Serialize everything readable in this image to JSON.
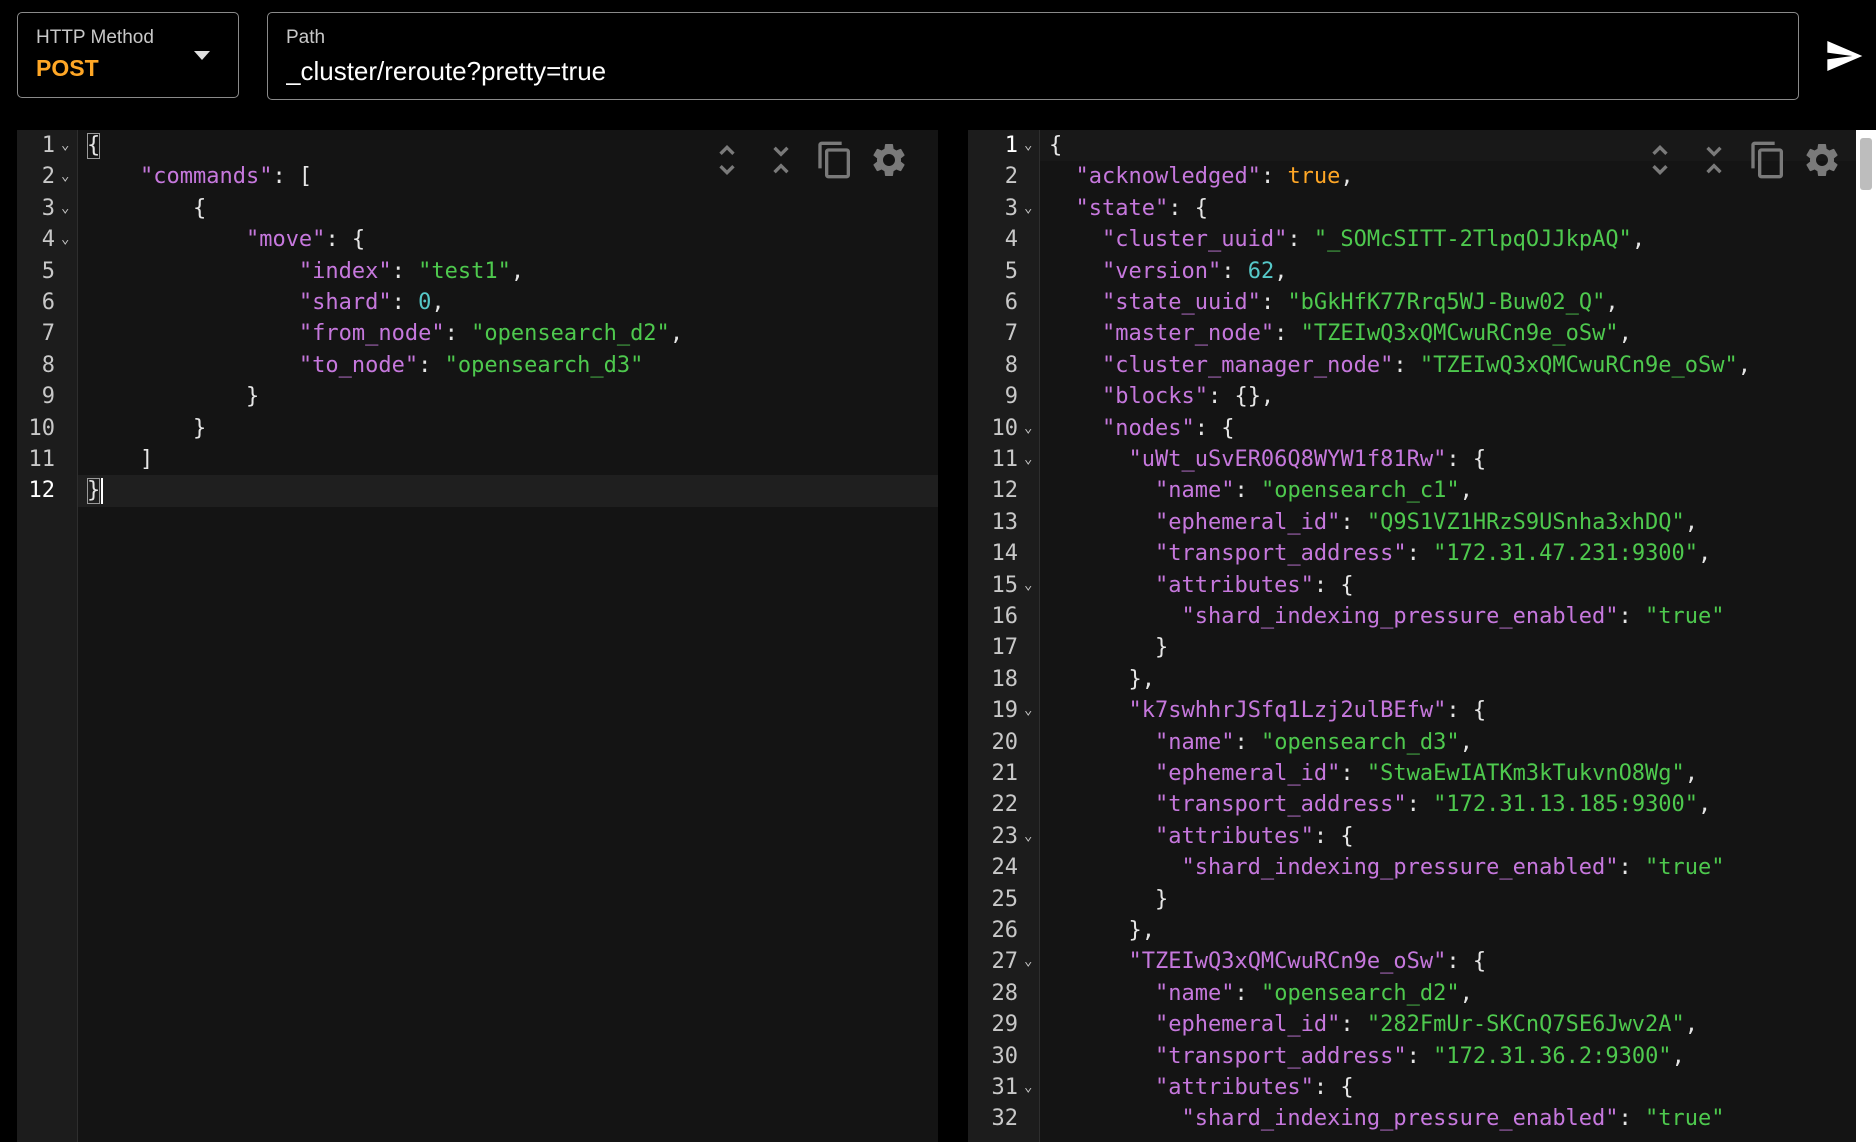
{
  "request": {
    "method_label": "HTTP Method",
    "method": "POST",
    "path_label": "Path",
    "path": "_cluster/reroute?pretty=true"
  },
  "icons": {
    "send": "send-icon",
    "expand_all": "unfold-more-icon",
    "collapse_all": "unfold-less-icon",
    "copy": "copy-icon",
    "settings": "gear-icon"
  },
  "colors": {
    "method": "#ffa726",
    "json_key": "#c678dd",
    "json_string": "#4ec94e",
    "json_number": "#56c8c8",
    "json_boolean": "#ffa726"
  },
  "request_editor": {
    "lines": [
      {
        "n": "1",
        "fold": true,
        "text": "{"
      },
      {
        "n": "2",
        "fold": true,
        "text": "    \"commands\": ["
      },
      {
        "n": "3",
        "fold": true,
        "text": "        {"
      },
      {
        "n": "4",
        "fold": true,
        "text": "            \"move\": {"
      },
      {
        "n": "5",
        "fold": false,
        "text": "                \"index\": \"test1\","
      },
      {
        "n": "6",
        "fold": false,
        "text": "                \"shard\": 0,"
      },
      {
        "n": "7",
        "fold": false,
        "text": "                \"from_node\": \"opensearch_d2\","
      },
      {
        "n": "8",
        "fold": false,
        "text": "                \"to_node\": \"opensearch_d3\""
      },
      {
        "n": "9",
        "fold": false,
        "text": "            }"
      },
      {
        "n": "10",
        "fold": false,
        "text": "        }"
      },
      {
        "n": "11",
        "fold": false,
        "text": "    ]"
      },
      {
        "n": "12",
        "fold": false,
        "text": "}"
      }
    ]
  },
  "response_editor": {
    "lines": [
      {
        "n": "1",
        "fold": true,
        "text": "{"
      },
      {
        "n": "2",
        "fold": false,
        "text": "  \"acknowledged\": true,"
      },
      {
        "n": "3",
        "fold": true,
        "text": "  \"state\": {"
      },
      {
        "n": "4",
        "fold": false,
        "text": "    \"cluster_uuid\": \"_SOMcSITT-2TlpqOJJkpAQ\","
      },
      {
        "n": "5",
        "fold": false,
        "text": "    \"version\": 62,"
      },
      {
        "n": "6",
        "fold": false,
        "text": "    \"state_uuid\": \"bGkHfK77Rrq5WJ-Buw02_Q\","
      },
      {
        "n": "7",
        "fold": false,
        "text": "    \"master_node\": \"TZEIwQ3xQMCwuRCn9e_oSw\","
      },
      {
        "n": "8",
        "fold": false,
        "text": "    \"cluster_manager_node\": \"TZEIwQ3xQMCwuRCn9e_oSw\","
      },
      {
        "n": "9",
        "fold": false,
        "text": "    \"blocks\": {},"
      },
      {
        "n": "10",
        "fold": true,
        "text": "    \"nodes\": {"
      },
      {
        "n": "11",
        "fold": true,
        "text": "      \"uWt_uSvER06Q8WYW1f81Rw\": {"
      },
      {
        "n": "12",
        "fold": false,
        "text": "        \"name\": \"opensearch_c1\","
      },
      {
        "n": "13",
        "fold": false,
        "text": "        \"ephemeral_id\": \"Q9S1VZ1HRzS9USnha3xhDQ\","
      },
      {
        "n": "14",
        "fold": false,
        "text": "        \"transport_address\": \"172.31.47.231:9300\","
      },
      {
        "n": "15",
        "fold": true,
        "text": "        \"attributes\": {"
      },
      {
        "n": "16",
        "fold": false,
        "text": "          \"shard_indexing_pressure_enabled\": \"true\""
      },
      {
        "n": "17",
        "fold": false,
        "text": "        }"
      },
      {
        "n": "18",
        "fold": false,
        "text": "      },"
      },
      {
        "n": "19",
        "fold": true,
        "text": "      \"k7swhhrJSfq1Lzj2ulBEfw\": {"
      },
      {
        "n": "20",
        "fold": false,
        "text": "        \"name\": \"opensearch_d3\","
      },
      {
        "n": "21",
        "fold": false,
        "text": "        \"ephemeral_id\": \"StwaEwIATKm3kTukvnO8Wg\","
      },
      {
        "n": "22",
        "fold": false,
        "text": "        \"transport_address\": \"172.31.13.185:9300\","
      },
      {
        "n": "23",
        "fold": true,
        "text": "        \"attributes\": {"
      },
      {
        "n": "24",
        "fold": false,
        "text": "          \"shard_indexing_pressure_enabled\": \"true\""
      },
      {
        "n": "25",
        "fold": false,
        "text": "        }"
      },
      {
        "n": "26",
        "fold": false,
        "text": "      },"
      },
      {
        "n": "27",
        "fold": true,
        "text": "      \"TZEIwQ3xQMCwuRCn9e_oSw\": {"
      },
      {
        "n": "28",
        "fold": false,
        "text": "        \"name\": \"opensearch_d2\","
      },
      {
        "n": "29",
        "fold": false,
        "text": "        \"ephemeral_id\": \"282FmUr-SKCnQ7SE6Jwv2A\","
      },
      {
        "n": "30",
        "fold": false,
        "text": "        \"transport_address\": \"172.31.36.2:9300\","
      },
      {
        "n": "31",
        "fold": true,
        "text": "        \"attributes\": {"
      },
      {
        "n": "32",
        "fold": false,
        "text": "          \"shard_indexing_pressure_enabled\": \"true\""
      }
    ]
  }
}
